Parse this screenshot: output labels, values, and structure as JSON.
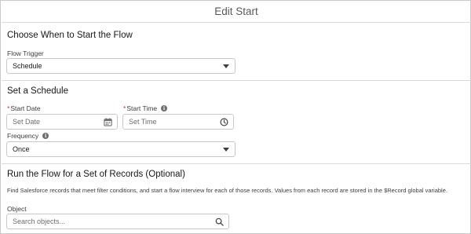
{
  "modal": {
    "title": "Edit Start"
  },
  "sections": {
    "trigger": {
      "title": "Choose When to Start the Flow",
      "flow_trigger_label": "Flow Trigger",
      "flow_trigger_value": "Schedule"
    },
    "schedule": {
      "title": "Set a Schedule",
      "start_date_label": "Start Date",
      "start_date_placeholder": "Set Date",
      "start_time_label": "Start Time",
      "start_time_placeholder": "Set Time",
      "frequency_label": "Frequency",
      "frequency_value": "Once",
      "required_marker": "*"
    },
    "records": {
      "title": "Run the Flow for a Set of Records (Optional)",
      "description": "Find Salesforce records that meet filter conditions, and start a flow interview for each of those records. Values from each record are stored in the $Record global variable.",
      "object_label": "Object",
      "object_placeholder": "Search objects..."
    }
  },
  "icons": {
    "info": "info-icon",
    "calendar": "calendar-icon",
    "clock": "clock-icon",
    "search": "search-icon",
    "dropdown": "chevron-down-icon"
  },
  "colors": {
    "required": "#c23934",
    "border": "#c9c9c9",
    "divider": "#dddbda",
    "text": "#3e3e3c"
  }
}
